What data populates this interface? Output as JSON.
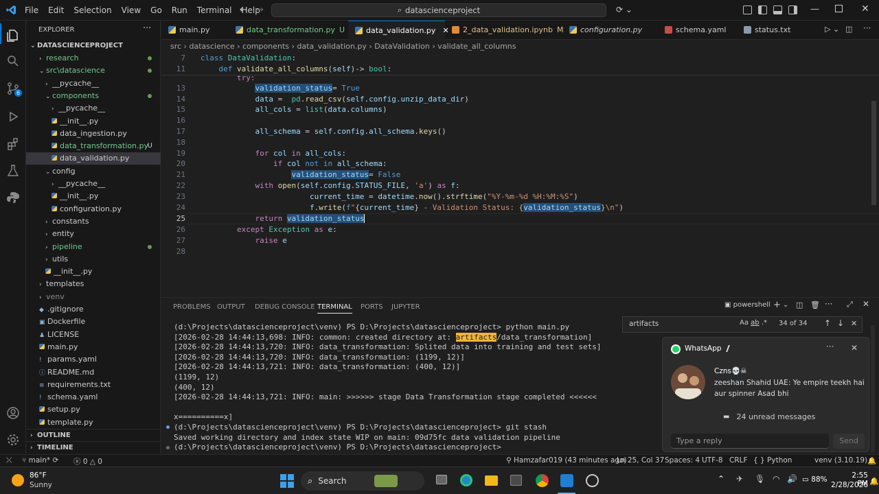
{
  "titlebar": {
    "menus": [
      "File",
      "Edit",
      "Selection",
      "View",
      "Go",
      "Run",
      "Terminal",
      "Help"
    ],
    "search": "datascienceproject"
  },
  "sidebar": {
    "header": "EXPLORER",
    "project": "DATASCIENCEPROJECT",
    "items": [
      {
        "label": "research",
        "color": "#73c991",
        "chev": "›",
        "indent": 1,
        "dot": true
      },
      {
        "label": "src\\datascience",
        "color": "#73c991",
        "chev": "⌄",
        "indent": 1,
        "dot": true
      },
      {
        "label": "__pycache__",
        "color": "#cccccc",
        "chev": "›",
        "indent": 2
      },
      {
        "label": "components",
        "color": "#73c991",
        "chev": "⌄",
        "indent": 2,
        "dot": true
      },
      {
        "label": "__pycache__",
        "color": "#cccccc",
        "chev": "›",
        "indent": 3
      },
      {
        "label": "__init__.py",
        "color": "#cccccc",
        "indent": 3,
        "py": true
      },
      {
        "label": "data_ingestion.py",
        "color": "#cccccc",
        "indent": 3,
        "py": true
      },
      {
        "label": "data_transformation.py",
        "color": "#73c991",
        "indent": 3,
        "py": true,
        "badge": "U"
      },
      {
        "label": "data_validation.py",
        "color": "#cccccc",
        "indent": 3,
        "py": true,
        "selected": true
      },
      {
        "label": "config",
        "color": "#cccccc",
        "chev": "⌄",
        "indent": 2
      },
      {
        "label": "__pycache__",
        "color": "#cccccc",
        "chev": "›",
        "indent": 3
      },
      {
        "label": "__init__.py",
        "color": "#cccccc",
        "indent": 3,
        "py": true
      },
      {
        "label": "configuration.py",
        "color": "#cccccc",
        "indent": 3,
        "py": true
      },
      {
        "label": "constants",
        "color": "#cccccc",
        "chev": "›",
        "indent": 2
      },
      {
        "label": "entity",
        "color": "#cccccc",
        "chev": "›",
        "indent": 2
      },
      {
        "label": "pipeline",
        "color": "#73c991",
        "chev": "›",
        "indent": 2,
        "dot": true
      },
      {
        "label": "utils",
        "color": "#cccccc",
        "chev": "›",
        "indent": 2
      },
      {
        "label": "__init__.py",
        "color": "#cccccc",
        "indent": 2,
        "py": true
      },
      {
        "label": "templates",
        "color": "#cccccc",
        "chev": "›",
        "indent": 1
      },
      {
        "label": "venv",
        "color": "#8b8b8b",
        "chev": "›",
        "indent": 1
      },
      {
        "label": ".gitignore",
        "color": "#cccccc",
        "indent": 1,
        "glyph": "◆"
      },
      {
        "label": "Dockerfile",
        "color": "#cccccc",
        "indent": 1,
        "glyph": "▣"
      },
      {
        "label": "LICENSE",
        "color": "#cccccc",
        "indent": 1,
        "glyph": "♟"
      },
      {
        "label": "main.py",
        "color": "#cccccc",
        "indent": 1,
        "py": true
      },
      {
        "label": "params.yaml",
        "color": "#cccccc",
        "indent": 1,
        "glyph": "!"
      },
      {
        "label": "README.md",
        "color": "#cccccc",
        "indent": 1,
        "glyph": "ⓘ"
      },
      {
        "label": "requirements.txt",
        "color": "#cccccc",
        "indent": 1,
        "glyph": "≡"
      },
      {
        "label": "schema.yaml",
        "color": "#cccccc",
        "indent": 1,
        "glyph": "!"
      },
      {
        "label": "setup.py",
        "color": "#cccccc",
        "indent": 1,
        "py": true
      },
      {
        "label": "template.py",
        "color": "#cccccc",
        "indent": 1,
        "py": true
      }
    ],
    "outline": "OUTLINE",
    "timeline": "TIMELINE"
  },
  "tabs": [
    {
      "label": "main.py",
      "badge": "",
      "color": "#cccccc"
    },
    {
      "label": "data_transformation.py",
      "badge": "U",
      "color": "#73c991"
    },
    {
      "label": "data_validation.py",
      "badge": "",
      "color": "#ffffff",
      "active": true
    },
    {
      "label": "2_data_validation.ipynb",
      "badge": "M",
      "color": "#e2c08d"
    },
    {
      "label": "configuration.py",
      "badge": "",
      "color": "#cccccc",
      "italic": true
    },
    {
      "label": "schema.yaml",
      "badge": "",
      "color": "#cccccc"
    },
    {
      "label": "status.txt",
      "badge": "",
      "color": "#cccccc"
    }
  ],
  "breadcrumb": [
    "src",
    "datascience",
    "components",
    "data_validation.py",
    "DataValidation",
    "validate_all_columns"
  ],
  "editor": {
    "lines": [
      "7",
      "11",
      "13",
      "14",
      "15",
      "16",
      "17",
      "18",
      "19",
      "20",
      "21",
      "22",
      "23",
      "24",
      "25",
      "26",
      "27",
      "28"
    ]
  },
  "panel": {
    "tabs": [
      "PROBLEMS",
      "OUTPUT",
      "DEBUG CONSOLE",
      "TERMINAL",
      "PORTS",
      "JUPYTER"
    ],
    "shell": "powershell",
    "find": "artifacts",
    "find_count": "34 of 34",
    "terminal": [
      "(d:\\Projects\\datascienceproject\\venv) PS D:\\Projects\\datascienceproject> python main.py",
      "[2026-02-28 14:44:13,698: INFO: common: created directory at: artifacts/data_transformation]",
      "[2026-02-28 14:44:13,720: INFO: data_transformation: Splited data into training and test sets]",
      "[2026-02-28 14:44:13,720: INFO: data_transformation: (1199, 12)]",
      "[2026-02-28 14:44:13,721: INFO: data_transformation: (400, 12)]",
      "(1199, 12)",
      "(400, 12)",
      "[2026-02-28 14:44:13,721: INFO: main: >>>>>> stage Data Transformation stage completed <<<<<<",
      "",
      "x==========x]",
      "(d:\\Projects\\datascienceproject\\venv) PS D:\\Projects\\datascienceproject> git stash",
      "Saved working directory and index state WIP on main: 09d75fc data validation pipeline",
      "(d:\\Projects\\datascienceproject\\venv) PS D:\\Projects\\datascienceproject> "
    ]
  },
  "whatsapp": {
    "app": "WhatsApp",
    "sender": "Czns💀☠",
    "message": "zeeshan Shahid UAE: Ye empire teekh hai aur spinner Asad bhi",
    "unread": "24 unread messages",
    "reply_placeholder": "Type a reply",
    "send": "Send"
  },
  "statusbar": {
    "branch": "main*",
    "errors": "0",
    "warnings": "0",
    "blame": "Hamzafar019 (43 minutes ago)",
    "position": "Ln 25, Col 37",
    "spaces": "Spaces: 4",
    "encoding": "UTF-8",
    "eol": "CRLF",
    "language": "Python",
    "env": "venv (3.10.19)"
  },
  "taskbar": {
    "temp": "86°F",
    "weather": "Sunny",
    "search": "Search",
    "time": "2:55 PM",
    "date": "2/28/2026",
    "battery": "88%"
  }
}
